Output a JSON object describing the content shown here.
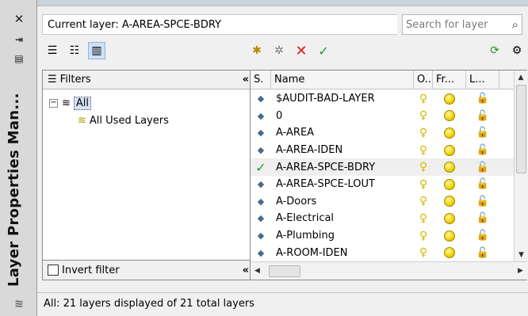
{
  "panel": {
    "title": "Layer Properties Man...",
    "current_layer": "Current layer: A-AREA-SPCE-BDRY",
    "search_placeholder": "Search for layer"
  },
  "filters": {
    "header": "Filters",
    "collapse_glyph": "«",
    "tree": [
      {
        "label": "All",
        "selected": true
      },
      {
        "label": "All Used Layers",
        "selected": false
      }
    ],
    "invert_filter_label": "Invert filter",
    "invert_checked": false
  },
  "layers": {
    "columns": [
      "S.",
      "Name",
      "O...",
      "Fr...",
      "L..."
    ],
    "rows": [
      {
        "name": "$AUDIT-BAD-LAYER",
        "current": false
      },
      {
        "name": "0",
        "current": false
      },
      {
        "name": "A-AREA",
        "current": false
      },
      {
        "name": "A-AREA-IDEN",
        "current": false
      },
      {
        "name": "A-AREA-SPCE-BDRY",
        "current": true
      },
      {
        "name": "A-AREA-SPCE-LOUT",
        "current": false
      },
      {
        "name": "A-Doors",
        "current": false
      },
      {
        "name": "A-Electrical",
        "current": false
      },
      {
        "name": "A-Plumbing",
        "current": false
      },
      {
        "name": "A-ROOM-IDEN",
        "current": false
      }
    ]
  },
  "status_text": "All: 21 layers displayed of 21 total layers",
  "colors": {
    "accent": "#1e9e2a",
    "delete": "#d42020",
    "bulb": "#d6b800"
  }
}
